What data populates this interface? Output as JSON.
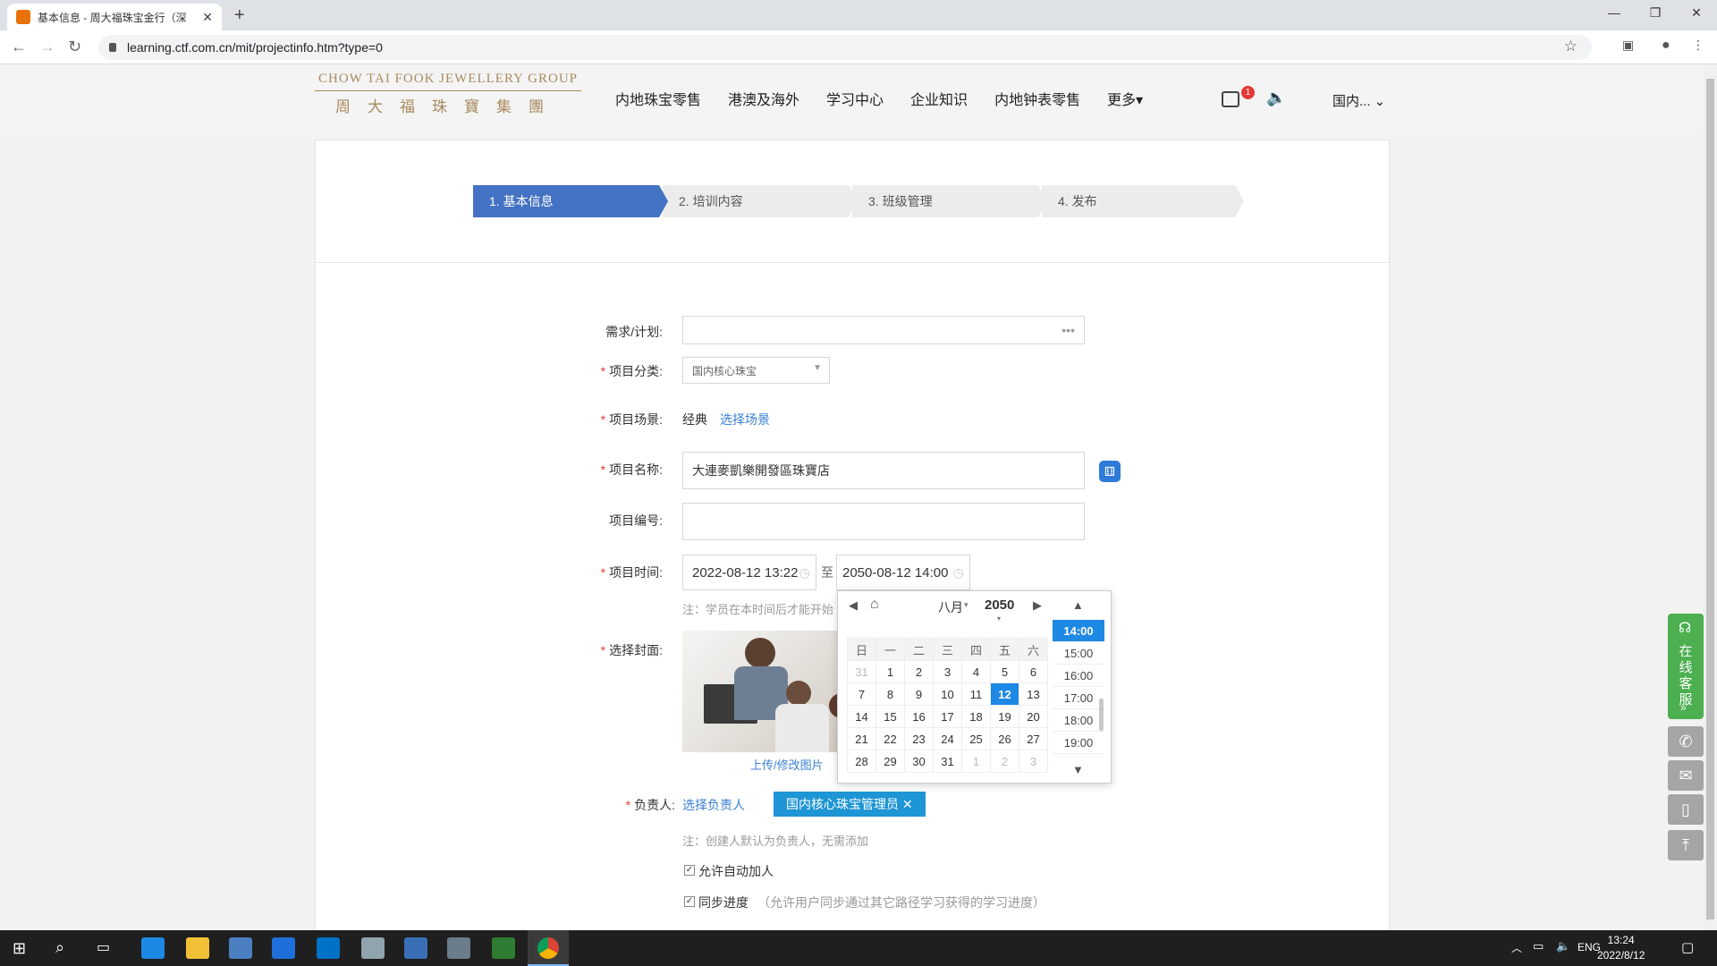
{
  "browser": {
    "tab_title": "基本信息 - 周大福珠宝金行（深",
    "url": "learning.ctf.com.cn/mit/projectinfo.htm?type=0"
  },
  "header": {
    "logo_en": "CHOW TAI FOOK JEWELLERY GROUP",
    "logo_cn": "周大福珠寶集團",
    "nav": [
      "内地珠宝零售",
      "港澳及海外",
      "学习中心",
      "企业知识",
      "内地钟表零售",
      "更多▾"
    ],
    "badge_count": "1",
    "region": "国内... ⌄"
  },
  "steps": [
    "1. 基本信息",
    "2. 培训内容",
    "3. 班级管理",
    "4. 发布"
  ],
  "form": {
    "demand_label": "需求/计划:",
    "demand_dots": "•••",
    "category_label": "项目分类:",
    "category_value": "国内核心珠宝",
    "scene_label": "项目场景:",
    "scene_value": "经典",
    "scene_link": "选择场景",
    "name_label": "项目名称:",
    "name_value": "大連麥凱樂開發區珠寶店",
    "code_label": "项目编号:",
    "time_label": "项目时间:",
    "start_time": "2022-08-12 13:22",
    "to": "至",
    "end_time": "2050-08-12 14:00",
    "time_note": "注：学员在本时间后才能开始",
    "cover_label": "选择封面:",
    "upload_link": "上传/修改图片",
    "owner_label": "负责人:",
    "owner_link": "选择负责人",
    "owner_tag": "国内核心珠宝管理员 ✕",
    "owner_note": "注：创建人默认为负责人，无需添加",
    "auto_join": "允许自动加人",
    "sync_progress": "同步进度",
    "sync_note": "（允许用户同步通过其它路径学习获得的学习进度）"
  },
  "datepicker": {
    "month": "八月",
    "year": "2050",
    "weekdays": [
      "日",
      "一",
      "二",
      "三",
      "四",
      "五",
      "六"
    ],
    "weeks": [
      [
        "31",
        "1",
        "2",
        "3",
        "4",
        "5",
        "6"
      ],
      [
        "7",
        "8",
        "9",
        "10",
        "11",
        "12",
        "13"
      ],
      [
        "14",
        "15",
        "16",
        "17",
        "18",
        "19",
        "20"
      ],
      [
        "21",
        "22",
        "23",
        "24",
        "25",
        "26",
        "27"
      ],
      [
        "28",
        "29",
        "30",
        "31",
        "1",
        "2",
        "3"
      ]
    ],
    "selected_day": "12",
    "times": [
      "14:00",
      "15:00",
      "16:00",
      "17:00",
      "18:00",
      "19:00"
    ],
    "selected_time": "14:00"
  },
  "side": {
    "kefu": "在线客服"
  },
  "taskbar": {
    "lang": "ENG",
    "time": "13:24",
    "date": "2022/8/12"
  }
}
